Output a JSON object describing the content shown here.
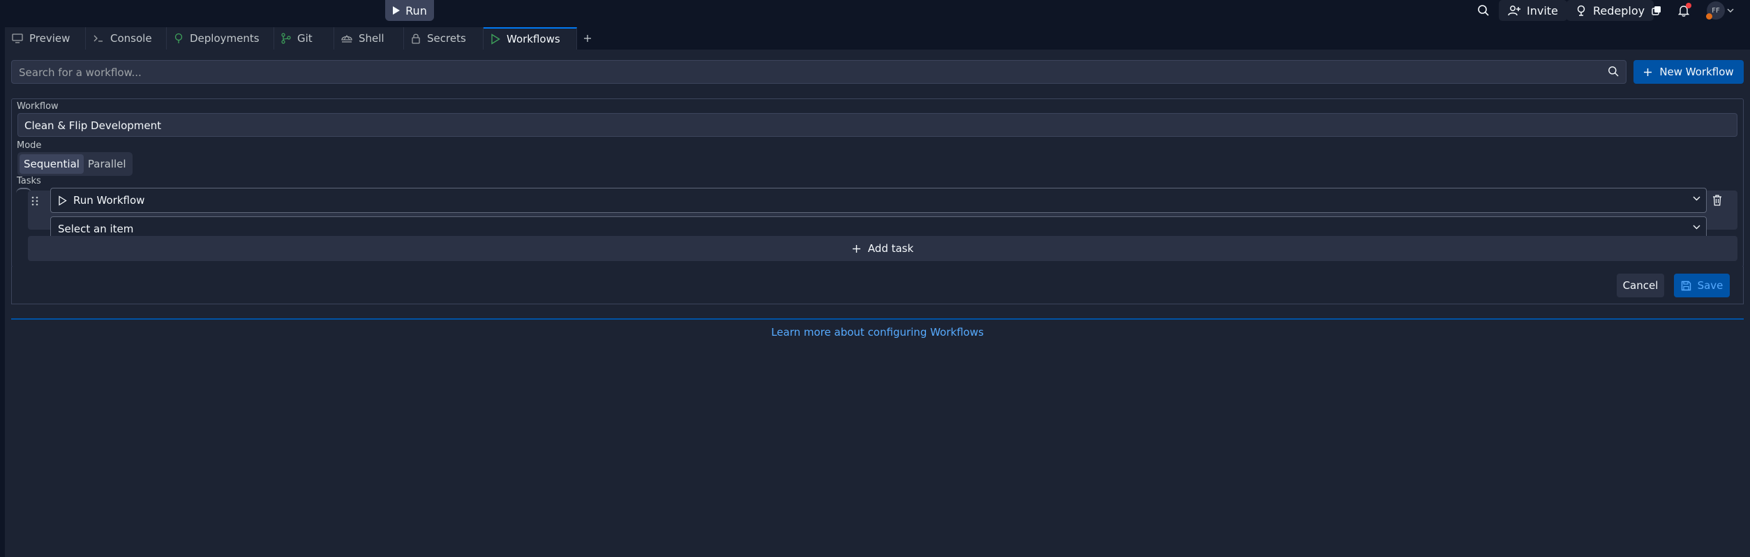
{
  "topbar": {
    "run_label": "Run",
    "invite_label": "Invite",
    "redeploy_label": "Redeploy",
    "avatar_initials": "FF"
  },
  "tabs": [
    {
      "label": "Preview",
      "icon": "monitor-icon"
    },
    {
      "label": "Console",
      "icon": "terminal-prompt-icon"
    },
    {
      "label": "Deployments",
      "icon": "deploy-icon"
    },
    {
      "label": "Git",
      "icon": "git-branch-icon"
    },
    {
      "label": "Shell",
      "icon": "shell-icon"
    },
    {
      "label": "Secrets",
      "icon": "lock-icon"
    },
    {
      "label": "Workflows",
      "icon": "play-icon",
      "active": true
    }
  ],
  "search": {
    "placeholder": "Search for a workflow..."
  },
  "new_workflow_label": "New Workflow",
  "form": {
    "workflow_label": "Workflow",
    "workflow_name": "Clean & Flip Development",
    "mode_label": "Mode",
    "modes": [
      {
        "label": "Sequential",
        "selected": true
      },
      {
        "label": "Parallel",
        "selected": false
      }
    ],
    "tasks_label": "Tasks",
    "tasks": [
      {
        "type_value": "Run Workflow",
        "item_value": "Select an item"
      }
    ],
    "add_task_label": "Add task",
    "cancel_label": "Cancel",
    "save_label": "Save"
  },
  "learn_more": "Learn more about configuring Workflows",
  "colors": {
    "background": "#0e1525",
    "surface": "#1c2333",
    "input": "#2b3245",
    "accent": "#0053a6",
    "link": "#57abff",
    "notification": "#f23f42"
  }
}
